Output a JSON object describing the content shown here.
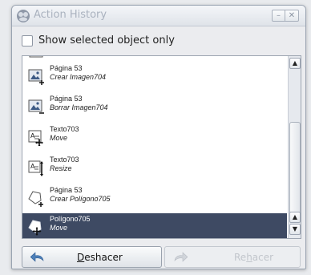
{
  "window": {
    "title": "Action History",
    "minimize_glyph": "–",
    "close_glyph": "✕"
  },
  "filter": {
    "label": "Show selected object only",
    "checked": false
  },
  "history": {
    "items": [
      {
        "title": "Página 53",
        "action": "Crear Imagen704",
        "icon": "image-add-icon"
      },
      {
        "title": "Página 53",
        "action": "Borrar Imagen704",
        "icon": "image-remove-icon"
      },
      {
        "title": "Texto703",
        "action": "Move",
        "icon": "text-move-icon"
      },
      {
        "title": "Texto703",
        "action": "Resize",
        "icon": "text-resize-icon"
      },
      {
        "title": "Página 53",
        "action": "Crear Polígono705",
        "icon": "polygon-add-icon"
      },
      {
        "title": "Polígono705",
        "action": "Move",
        "icon": "polygon-move-icon",
        "selected": true
      }
    ]
  },
  "buttons": {
    "undo": {
      "mnemonic": "D",
      "rest": "eshacer",
      "enabled": true
    },
    "redo": {
      "pre": "Re",
      "mnemonic": "h",
      "rest": "acer",
      "enabled": false
    }
  },
  "colors": {
    "selection": "#3e4a63",
    "title_text": "#aab2bf"
  }
}
